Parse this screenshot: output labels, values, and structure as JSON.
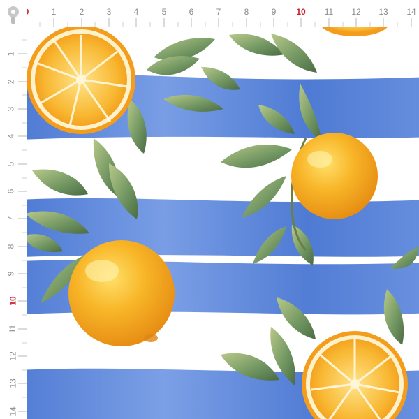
{
  "ruler": {
    "top_labels": [
      "0",
      "1",
      "2",
      "3",
      "4",
      "5",
      "6",
      "7",
      "8",
      "9",
      "10",
      "11",
      "12",
      "13",
      "14"
    ],
    "left_labels": [
      "1",
      "2",
      "3",
      "4",
      "5",
      "6",
      "7",
      "8",
      "9",
      "10",
      "11",
      "12",
      "13",
      "14"
    ],
    "accent_label": "10",
    "accent_color": "#c91f2a",
    "label_color": "#8a8a8a"
  },
  "fabric": {
    "pattern": "watercolor oranges with leaves on blue horizontal stripes",
    "stripe_color": "#4f7fd6",
    "background_color": "#ffffff",
    "orange_color": "#f4a71c",
    "leaf_color": "#7a9a62"
  }
}
